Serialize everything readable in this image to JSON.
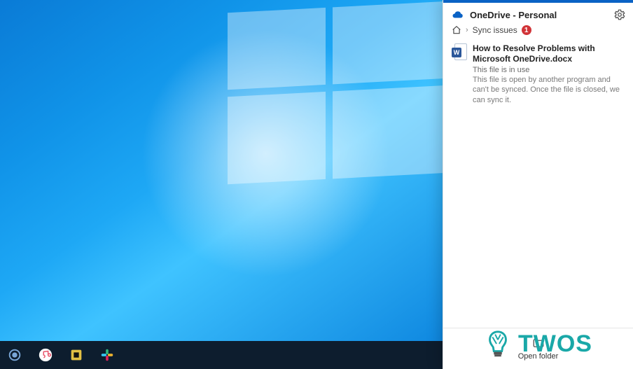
{
  "panel": {
    "title": "OneDrive - Personal",
    "breadcrumb": {
      "label": "Sync issues",
      "badge_count": "1"
    },
    "item": {
      "title": "How to Resolve Problems with Microsoft OneDrive.docx",
      "subtitle": "This file is in use",
      "description": "This file is open by another program and can't be synced. Once the file is closed, we can sync it."
    },
    "footer": {
      "open_folder": "Open folder"
    }
  },
  "watermark": {
    "text": "TWOS"
  }
}
